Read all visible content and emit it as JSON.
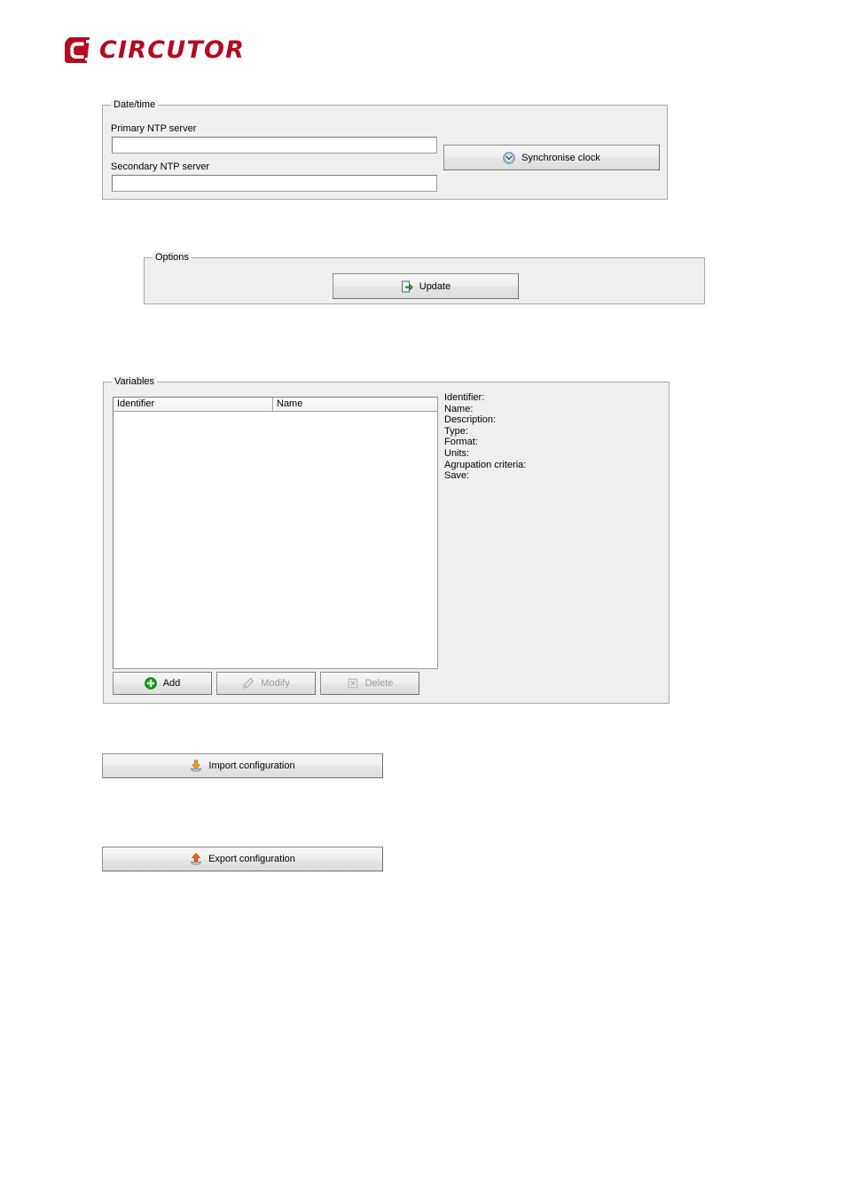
{
  "brand": {
    "name": "CIRCUTOR",
    "logo_icon": "circutor-c-mark",
    "color": "#b40a23"
  },
  "datetime_panel": {
    "legend": "Date/time",
    "primary_label": "Primary NTP server",
    "primary_value": "",
    "primary_placeholder": "",
    "secondary_label": "Secondary NTP server",
    "secondary_value": "",
    "secondary_placeholder": "",
    "sync_button": {
      "label": "Synchronise clock",
      "icon": "clock-icon",
      "enabled": true
    }
  },
  "options_panel": {
    "legend": "Options",
    "update_button": {
      "label": "Update",
      "icon": "update-arrow-document-icon",
      "enabled": true
    }
  },
  "variables_panel": {
    "legend": "Variables",
    "columns": [
      "Identifier",
      "Name"
    ],
    "rows": [],
    "details": [
      "Identifier:",
      "Name:",
      "Description:",
      "Type:",
      "Format:",
      "Units:",
      "Agrupation criteria:",
      "Save:"
    ],
    "buttons": [
      {
        "label": "Add",
        "icon": "plus-circle-icon",
        "enabled": true
      },
      {
        "label": "Modify",
        "icon": "pencil-icon",
        "enabled": false
      },
      {
        "label": "Delete",
        "icon": "delete-icon",
        "enabled": false
      }
    ]
  },
  "config_buttons": {
    "import": {
      "label": "Import configuration",
      "icon": "import-down-arrow-icon",
      "enabled": true
    },
    "export": {
      "label": "Export configuration",
      "icon": "export-up-arrow-icon",
      "enabled": true
    }
  }
}
